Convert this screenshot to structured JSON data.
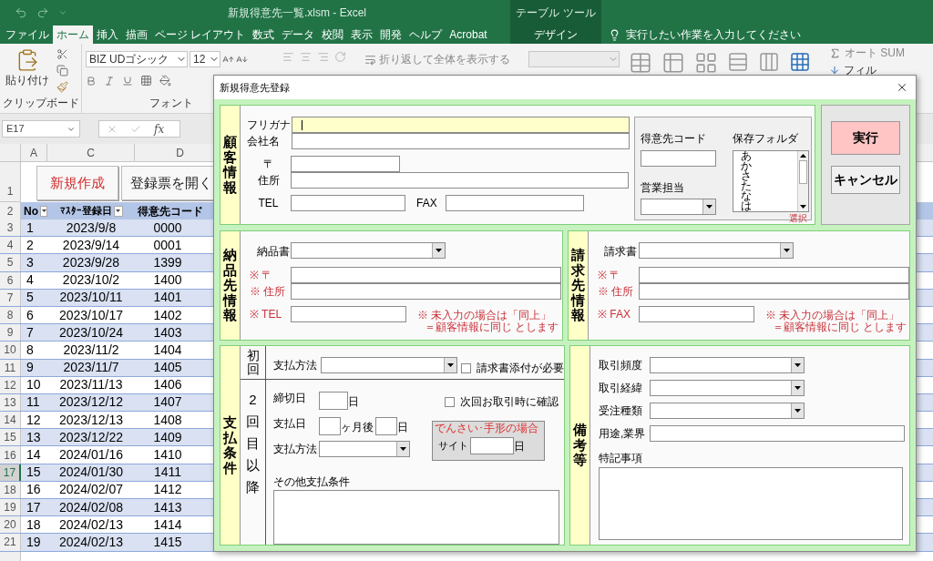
{
  "excel": {
    "title": "新規得意先一覧.xlsm - Excel",
    "context_label": "テーブル ツール",
    "tabs": [
      {
        "label": "ファイル",
        "selected": false,
        "kind": "normal"
      },
      {
        "label": "ホーム",
        "selected": true,
        "kind": "normal"
      },
      {
        "label": "挿入",
        "selected": false,
        "kind": "normal"
      },
      {
        "label": "描画",
        "selected": false,
        "kind": "normal"
      },
      {
        "label": "ページ レイアウト",
        "selected": false,
        "kind": "normal"
      },
      {
        "label": "数式",
        "selected": false,
        "kind": "normal"
      },
      {
        "label": "データ",
        "selected": false,
        "kind": "normal"
      },
      {
        "label": "校閲",
        "selected": false,
        "kind": "normal"
      },
      {
        "label": "表示",
        "selected": false,
        "kind": "normal"
      },
      {
        "label": "開発",
        "selected": false,
        "kind": "normal"
      },
      {
        "label": "ヘルプ",
        "selected": false,
        "kind": "normal"
      },
      {
        "label": "Acrobat",
        "selected": false,
        "kind": "normal"
      },
      {
        "label": "デザイン",
        "selected": false,
        "kind": "context"
      }
    ],
    "tell_me": "実行したい作業を入力してください",
    "ribbon": {
      "paste": "貼り付け",
      "clipboard_group": "クリップボード",
      "font_name": "BIZ UDゴシック",
      "font_size": "12",
      "font_group": "フォント",
      "wrap_text": "折り返して全体を表示する",
      "autosum": "オート SUM",
      "fill": "フィル"
    },
    "name_box": "E17",
    "function_label": "fx",
    "columns": [
      "A",
      "C",
      "D"
    ],
    "top_row_numbers": [
      "1",
      "2"
    ],
    "sheet_buttons": [
      {
        "label": "新規作成",
        "kind": "primary"
      },
      {
        "label": "登録票を開く",
        "kind": "normal"
      }
    ],
    "header": [
      "No",
      "ﾏｽﾀｰ登録日",
      "得意先コード"
    ],
    "rows": [
      {
        "row": "3",
        "cells": [
          "1",
          "2023/9/8",
          "0000"
        ],
        "selected": false
      },
      {
        "row": "4",
        "cells": [
          "2",
          "2023/9/14",
          "0001"
        ],
        "selected": false
      },
      {
        "row": "5",
        "cells": [
          "3",
          "2023/9/28",
          "1399"
        ],
        "selected": false
      },
      {
        "row": "6",
        "cells": [
          "4",
          "2023/10/2",
          "1400"
        ],
        "selected": false
      },
      {
        "row": "7",
        "cells": [
          "5",
          "2023/10/11",
          "1401"
        ],
        "selected": false
      },
      {
        "row": "8",
        "cells": [
          "6",
          "2023/10/17",
          "1402"
        ],
        "selected": false
      },
      {
        "row": "9",
        "cells": [
          "7",
          "2023/10/24",
          "1403"
        ],
        "selected": false
      },
      {
        "row": "10",
        "cells": [
          "8",
          "2023/11/2",
          "1404"
        ],
        "selected": false
      },
      {
        "row": "11",
        "cells": [
          "9",
          "2023/11/7",
          "1405"
        ],
        "selected": false
      },
      {
        "row": "12",
        "cells": [
          "10",
          "2023/11/13",
          "1406"
        ],
        "selected": false
      },
      {
        "row": "13",
        "cells": [
          "11",
          "2023/12/12",
          "1407"
        ],
        "selected": false
      },
      {
        "row": "14",
        "cells": [
          "12",
          "2023/12/13",
          "1408"
        ],
        "selected": false
      },
      {
        "row": "15",
        "cells": [
          "13",
          "2023/12/22",
          "1409"
        ],
        "selected": false
      },
      {
        "row": "16",
        "cells": [
          "14",
          "2024/01/16",
          "1410"
        ],
        "selected": false
      },
      {
        "row": "17",
        "cells": [
          "15",
          "2024/01/30",
          "1411"
        ],
        "selected": true
      },
      {
        "row": "18",
        "cells": [
          "16",
          "2024/02/07",
          "1412"
        ],
        "selected": false
      },
      {
        "row": "19",
        "cells": [
          "17",
          "2024/02/08",
          "1413"
        ],
        "selected": false
      },
      {
        "row": "20",
        "cells": [
          "18",
          "2024/02/13",
          "1414"
        ],
        "selected": false
      },
      {
        "row": "21",
        "cells": [
          "19",
          "2024/02/13",
          "1415"
        ],
        "selected": false
      }
    ]
  },
  "dialog": {
    "title": "新規得意先登録",
    "customer": {
      "label": "顧客情報",
      "furigana": {
        "label": "フリガナ",
        "focused": true
      },
      "company": "会社名",
      "postal": "〒",
      "address": "住所",
      "tel": "TEL",
      "fax": "FAX",
      "code": "得意先コード",
      "sales_rep": "営業担当",
      "folder": {
        "label": "保存フォルダ",
        "items": [
          "あ",
          "か",
          "さ",
          "た",
          "な",
          "は"
        ],
        "note": "選択"
      }
    },
    "buttons": [
      {
        "label": "実行",
        "kind": "primary"
      },
      {
        "label": "キャンセル",
        "kind": "normal"
      }
    ],
    "delivery": {
      "label": "納品先情報",
      "doc": "納品書",
      "postal": "※ 〒",
      "address": "※ 住所",
      "phone": "※ TEL",
      "note": [
        "※ 未入力の場合は「同上」",
        "＝顧客情報に同じ とします"
      ]
    },
    "billing": {
      "label": "請求先情報",
      "doc": "請求書",
      "postal": "※ 〒",
      "address": "※ 住所",
      "phone": "※ FAX",
      "note": [
        "※ 未入力の場合は「同上」",
        "＝顧客情報に同じ とします"
      ]
    },
    "payment": {
      "label": "支払条件",
      "first": {
        "label": "初回",
        "method": "支払方法",
        "attach": {
          "label": "請求書添付が必要",
          "checked": false
        }
      },
      "later": {
        "label": "2回目以降",
        "cutoff": "締切日",
        "cutoff_unit": "日",
        "payday": "支払日",
        "months_unit": "ヶ月後",
        "day_unit": "日",
        "method": "支払方法",
        "confirm": {
          "label": "次回お取引時に確認",
          "checked": false
        },
        "bill": {
          "title": "でんさい･手形の場合",
          "site": "サイト",
          "unit": "日"
        },
        "other": "その他支払条件"
      }
    },
    "remarks": {
      "label": "備考等",
      "selects": [
        "取引頻度",
        "取引経緯",
        "受注種類"
      ],
      "usage": "用途,業界",
      "special": "特記事項"
    }
  }
}
